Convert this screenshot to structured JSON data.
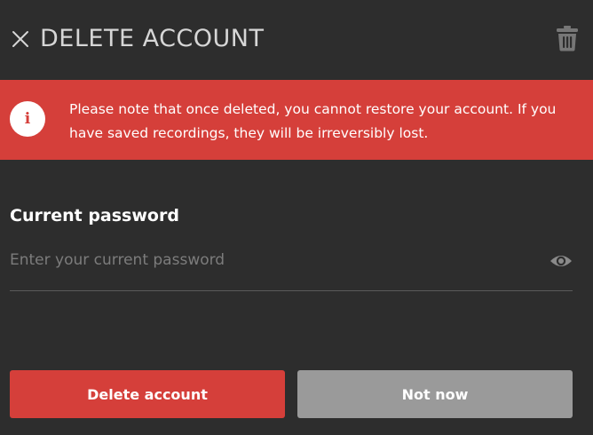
{
  "header": {
    "title": "DELETE ACCOUNT",
    "close_icon": "close-icon",
    "trash_icon": "trash-icon"
  },
  "warning": {
    "icon": "info-icon",
    "icon_glyph": "i",
    "text": "Please note that once deleted, you cannot restore your account. If you have saved recordings, they will be irreversibly lost."
  },
  "password_field": {
    "label": "Current password",
    "placeholder": "Enter your current password",
    "value": "",
    "visibility_icon": "eye-icon"
  },
  "actions": {
    "delete_label": "Delete account",
    "cancel_label": "Not now"
  },
  "colors": {
    "background": "#2d2d2d",
    "danger": "#d53f3a",
    "secondary_button": "#9a9a9a",
    "text": "#ffffff",
    "muted_text": "#7c7c7c"
  }
}
